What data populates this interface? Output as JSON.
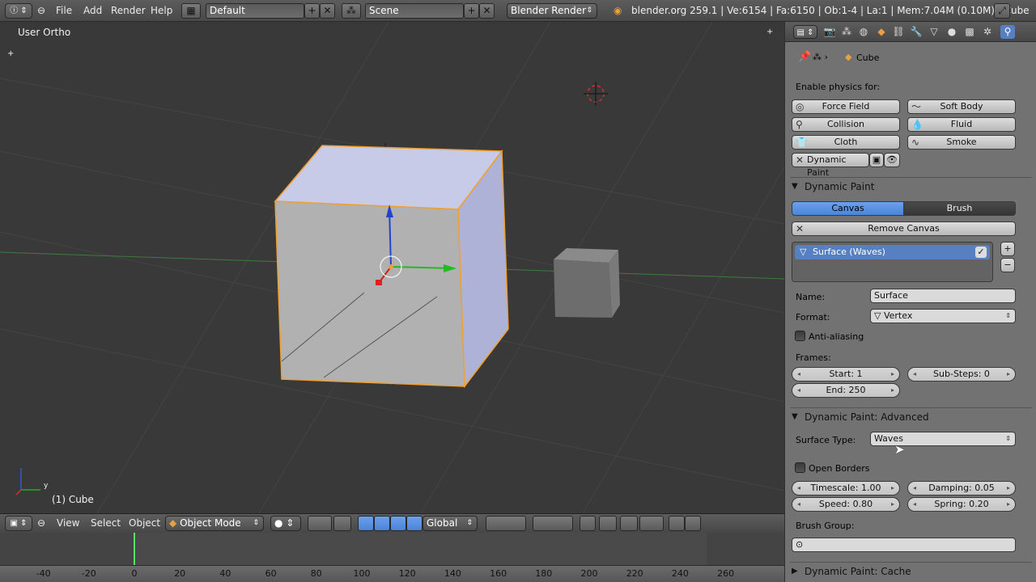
{
  "topbar": {
    "menus": [
      "File",
      "Add",
      "Render",
      "Help"
    ],
    "screen_layout": "Default",
    "scene": "Scene",
    "render_engine": "Blender Render",
    "stats": "blender.org 259.1 | Ve:6154 | Fa:6150 | Ob:1-4 | La:1 | Mem:7.04M (0.10M) | Cube"
  },
  "viewport": {
    "view_label": "User Ortho",
    "object_label": "(1) Cube",
    "axis_y": "y"
  },
  "vpheader": {
    "menus": [
      "View",
      "Select",
      "Object"
    ],
    "mode": "Object Mode",
    "orientation": "Global"
  },
  "timeline": {
    "ticks": [
      "-40",
      "-20",
      "0",
      "20",
      "40",
      "60",
      "80",
      "100",
      "120",
      "140",
      "160",
      "180",
      "200",
      "220",
      "240",
      "260"
    ],
    "current_frame": 1
  },
  "props": {
    "breadcrumb": "Cube",
    "enable_physics_label": "Enable physics for:",
    "physics": {
      "force_field": "Force Field",
      "soft_body": "Soft Body",
      "collision": "Collision",
      "fluid": "Fluid",
      "cloth": "Cloth",
      "smoke": "Smoke",
      "dynamic_paint": "Dynamic Paint"
    },
    "dp_section": "Dynamic Paint",
    "canvas_tab": "Canvas",
    "brush_tab": "Brush",
    "remove_canvas": "Remove Canvas",
    "surface_item": "Surface (Waves)",
    "name_label": "Name:",
    "name_value": "Surface",
    "format_label": "Format:",
    "format_value": "Vertex",
    "antialiasing_label": "Anti-aliasing",
    "frames_label": "Frames:",
    "start": "Start: 1",
    "end": "End: 250",
    "substeps": "Sub-Steps: 0",
    "adv_section": "Dynamic Paint: Advanced",
    "surface_type_label": "Surface Type:",
    "surface_type_value": "Waves",
    "open_borders_label": "Open Borders",
    "timescale": "Timescale: 1.00",
    "damping": "Damping: 0.05",
    "speed": "Speed: 0.80",
    "spring": "Spring: 0.20",
    "brush_group_label": "Brush Group:",
    "cache_section": "Dynamic Paint: Cache"
  },
  "colors": {
    "accent": "#5680c2",
    "panel": "#727272",
    "viewport": "#393939",
    "selection_outline": "#f0a030"
  }
}
